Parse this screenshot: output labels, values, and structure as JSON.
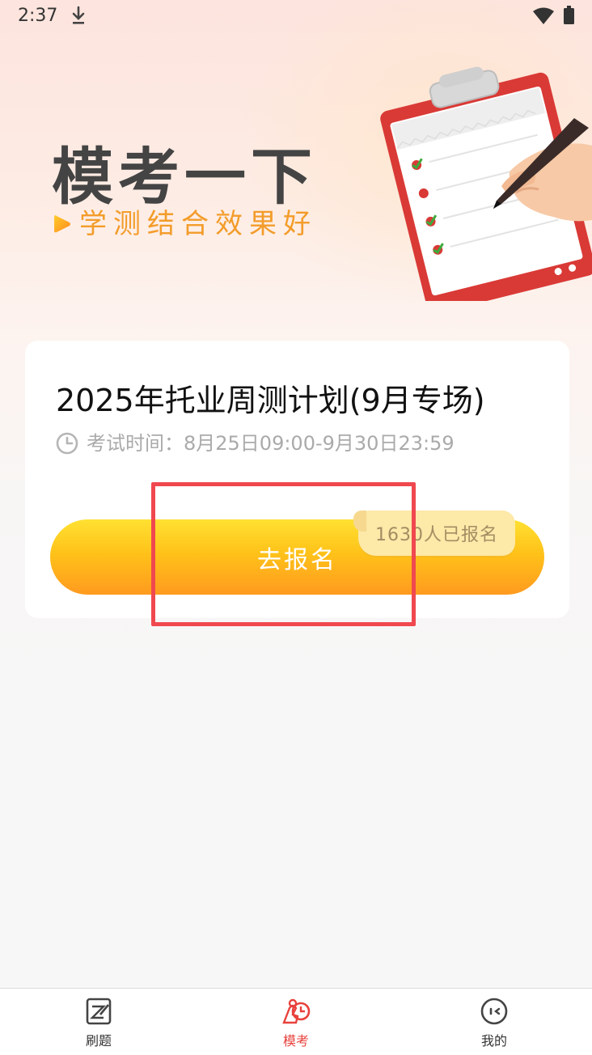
{
  "status_bar": {
    "time": "2:37"
  },
  "hero": {
    "title": "模考一下",
    "subtitle": "学测结合效果好"
  },
  "exam_card": {
    "title": "2025年托业周测计划(9月专场)",
    "time_text": "考试时间：8月25日09:00-9月30日23:59",
    "button_label": "去报名",
    "signup_count": "1630人已报名"
  },
  "bottom_nav": {
    "items": [
      {
        "label": "刷题",
        "icon": "practice-icon",
        "active": false
      },
      {
        "label": "模考",
        "icon": "mock-exam-icon",
        "active": true
      },
      {
        "label": "我的",
        "icon": "profile-icon",
        "active": false
      }
    ]
  },
  "colors": {
    "accent": "#e8413c",
    "button_top": "#ffe132",
    "button_bottom": "#ff9a1f",
    "subtitle": "#f39c2a",
    "highlight": "#f0484f"
  }
}
